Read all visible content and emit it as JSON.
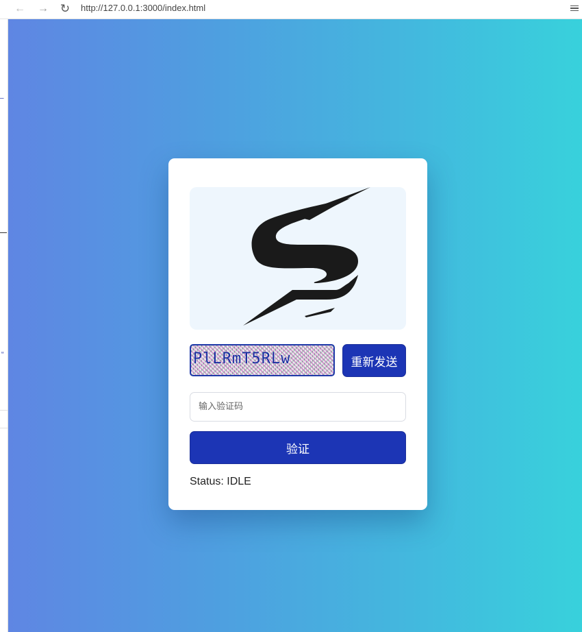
{
  "browser": {
    "back_icon": "arrow-left-icon",
    "forward_icon": "arrow-right-icon",
    "reload_icon": "reload-icon",
    "url": "http://127.0.0.1:3000/index.html",
    "menu_icon": "hamburger-menu-icon"
  },
  "page": {
    "background_gradient": [
      "#5f86e3",
      "#38d1dc"
    ],
    "logo": {
      "icon": "stylized-s-logo",
      "color": "#1a1a1a",
      "background": "#eef6fd"
    },
    "captcha": {
      "text": "PlLRmT5RLw"
    },
    "resend_label": "重新发送",
    "code_input": {
      "value": "",
      "placeholder": "输入验证码"
    },
    "verify_label": "验证",
    "status": "Status: IDLE",
    "accent_color": "#1c35b5"
  }
}
